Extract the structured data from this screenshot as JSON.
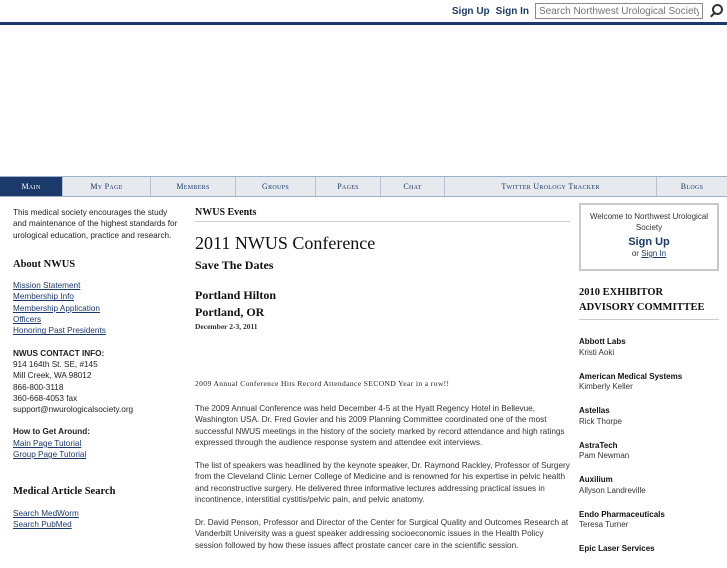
{
  "header": {
    "sign_up": "Sign Up",
    "sign_in": "Sign In",
    "search_placeholder": "Search Northwest Urological Society"
  },
  "nav": [
    {
      "label": "Main",
      "active": true
    },
    {
      "label": "My Page"
    },
    {
      "label": "Members"
    },
    {
      "label": "Groups"
    },
    {
      "label": "Pages"
    },
    {
      "label": "Chat"
    },
    {
      "label": "Twitter Urology Tracker"
    },
    {
      "label": "Blogs"
    }
  ],
  "left": {
    "intro": "This medical society encourages the study and maintenance of the highest standards for urological education, practice and research.",
    "about_title": "About NWUS",
    "about_links": [
      "Mission Statement",
      "Membership Info",
      "Membership Application",
      "Officers",
      "Honoring Past Presidents"
    ],
    "contact_label": "NWUS CONTACT INFO:",
    "contact_lines": [
      "914 164th St. SE, #145",
      "Mill Creek, WA 98012",
      "866-800-3118",
      "360-668-4053 fax",
      "support@nwurologicalsociety.org"
    ],
    "getaround_label": "How to Get Around:",
    "getaround_links": [
      "Main Page Tutorial",
      "Group Page Tutorial"
    ],
    "search_title": "Medical Article Search",
    "search_links": [
      "Search MedWorm",
      "Search PubMed"
    ]
  },
  "main": {
    "section_title": "NWUS Events",
    "conf_title": "2011 NWUS Conference",
    "save_dates": "Save The Dates",
    "venue_line1": "Portland Hilton",
    "venue_line2": "Portland, OR",
    "dates": "December 2-3, 2011",
    "banner": "2009 Annual Conference Hits Record Attendance SECOND Year in a row!!",
    "para1": "The 2009 Annual Conference was held December 4-5 at the Hyatt Regency Hotel in Bellevue, Washington USA. Dr. Fred Govier and his 2009 Planning Committee coordinated one of the most successful NWUS meetings in the history of the society marked by record attendance and high ratings expressed through the audience response system and attendee exit interviews.",
    "para2": "The list of speakers was headlined by the keynote speaker, Dr. Raymond Rackley, Professor of Surgery from the Cleveland Clinic Lerner College of Medicine and is renowned for his expertise in pelvic health and reconstructive surgery. He delivered three informative lectures addressing practical issues in incontinence, interstitial cystitis/pelvic pain, and pelvic anatomy.",
    "para3": "Dr. David Penson, Professor and Director of the Center for Surgical Quality and Outcomes Research at Vanderbilt University was a guest speaker addressing socioeconomic issues in the Health Policy session followed by how these issues affect prostate cancer care in the scientific session."
  },
  "right": {
    "welcome": "Welcome to Northwest Urological Society",
    "sign_up": "Sign Up",
    "or": "or",
    "sign_in": "Sign In",
    "exhibitor_title": "2010 EXHIBITOR ADVISORY COMMITTEE",
    "exhibitors": [
      {
        "name": "Abbott Labs",
        "person": "Kristi Aoki"
      },
      {
        "name": "American Medical Systems",
        "person": "Kimberly Keller"
      },
      {
        "name": "Astellas",
        "person": "Rick Thorpe"
      },
      {
        "name": "AstraTech",
        "person": "Pam Newman"
      },
      {
        "name": "Auxilium",
        "person": "Allyson Landreville"
      },
      {
        "name": "Endo Pharmaceuticals",
        "person": "Teresa Turner"
      },
      {
        "name": "Epic Laser Services",
        "person": ""
      }
    ]
  }
}
